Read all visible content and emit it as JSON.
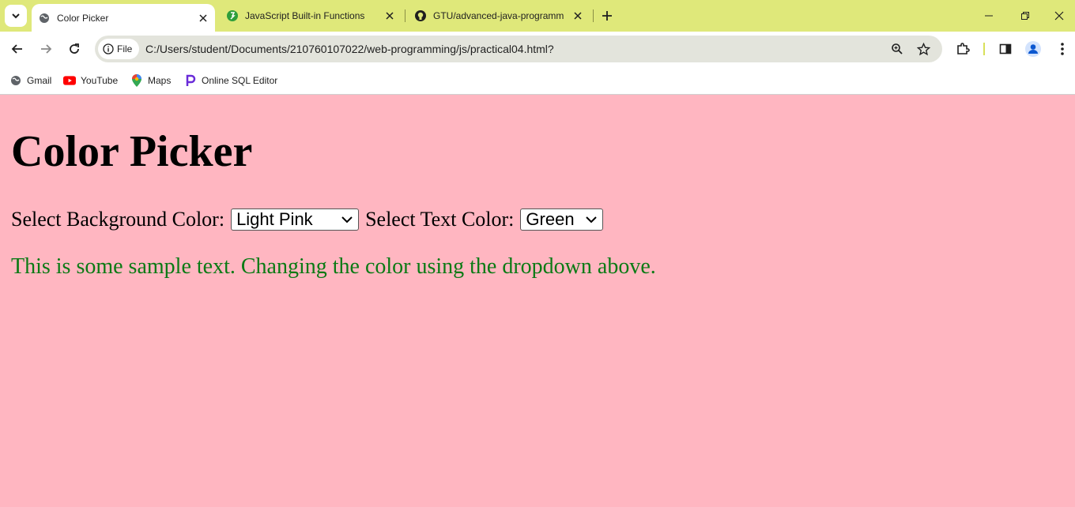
{
  "browser": {
    "tabs": [
      {
        "title": "Color Picker",
        "active": true,
        "icon": "globe-icon"
      },
      {
        "title": "JavaScript Built-in Functions",
        "active": false,
        "icon": "site-favicon-icon"
      },
      {
        "title": "GTU/advanced-java-programm",
        "active": false,
        "icon": "github-icon"
      }
    ],
    "address": {
      "chip_label": "File",
      "url": "C:/Users/student/Documents/210760107022/web-programming/js/practical04.html?"
    },
    "bookmarks": [
      {
        "label": "Gmail",
        "icon": "globe-icon"
      },
      {
        "label": "YouTube",
        "icon": "youtube-icon"
      },
      {
        "label": "Maps",
        "icon": "maps-pin-icon"
      },
      {
        "label": "Online SQL Editor",
        "icon": "sql-editor-icon"
      }
    ],
    "colors": {
      "titlebar": "#dfe87a",
      "page_bg": "#ffb6c1",
      "text": "#0a7a14"
    }
  },
  "page": {
    "title": "Color Picker",
    "bg_label": "Select Background Color:",
    "bg_selected": "Light Pink",
    "text_label": "Select Text Color:",
    "text_selected": "Green",
    "sample_text": "This is some sample text. Changing the color using the dropdown above."
  }
}
